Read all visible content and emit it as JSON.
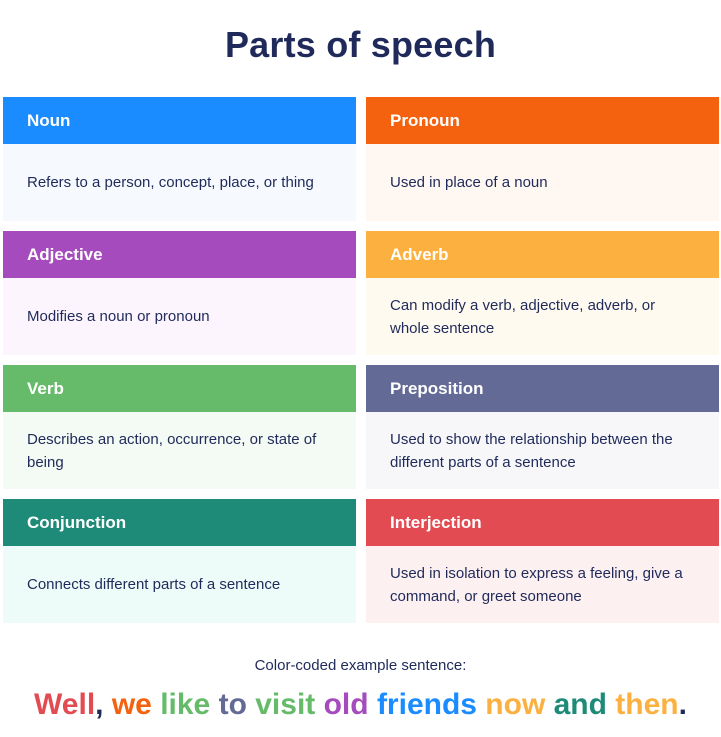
{
  "title": "Parts of speech",
  "cards": [
    {
      "name": "Noun",
      "definition": "Refers to a person, concept, place, or thing",
      "header_color": "#1a8cff",
      "body_color": "#f6faff"
    },
    {
      "name": "Pronoun",
      "definition": "Used in place of a noun",
      "header_color": "#f5620f",
      "body_color": "#fff7f1"
    },
    {
      "name": "Adjective",
      "definition": "Modifies a noun or pronoun",
      "header_color": "#a64bbd",
      "body_color": "#fcf5fd"
    },
    {
      "name": "Adverb",
      "definition": "Can modify a verb, adjective, adverb, or whole sentence",
      "header_color": "#fbb040",
      "body_color": "#fffaf0"
    },
    {
      "name": "Verb",
      "definition": "Describes an action, occurrence, or state of being",
      "header_color": "#66bb6a",
      "body_color": "#f4faf4"
    },
    {
      "name": "Preposition",
      "definition": "Used to show the relationship between the different parts of a sentence",
      "header_color": "#636a96",
      "body_color": "#f7f7f9"
    },
    {
      "name": "Conjunction",
      "definition": "Connects different parts of a sentence",
      "header_color": "#1e8b78",
      "body_color": "#eefcf9"
    },
    {
      "name": "Interjection",
      "definition": "Used in isolation to express a feeling, give a command, or greet someone",
      "header_color": "#e24b52",
      "body_color": "#fdf0f1"
    }
  ],
  "caption": "Color-coded example sentence:",
  "example_sentence": [
    {
      "text": "Well",
      "color": "#e24b52"
    },
    {
      "text": ", ",
      "color": "#1f2a5a"
    },
    {
      "text": "we ",
      "color": "#f5620f"
    },
    {
      "text": "like ",
      "color": "#66bb6a"
    },
    {
      "text": "to ",
      "color": "#636a96"
    },
    {
      "text": "visit ",
      "color": "#66bb6a"
    },
    {
      "text": "old ",
      "color": "#a64bbd"
    },
    {
      "text": "friends ",
      "color": "#1a8cff"
    },
    {
      "text": "now ",
      "color": "#fbb040"
    },
    {
      "text": "and ",
      "color": "#1e8b78"
    },
    {
      "text": "then",
      "color": "#fbb040"
    },
    {
      "text": ".",
      "color": "#1f2a5a"
    }
  ]
}
